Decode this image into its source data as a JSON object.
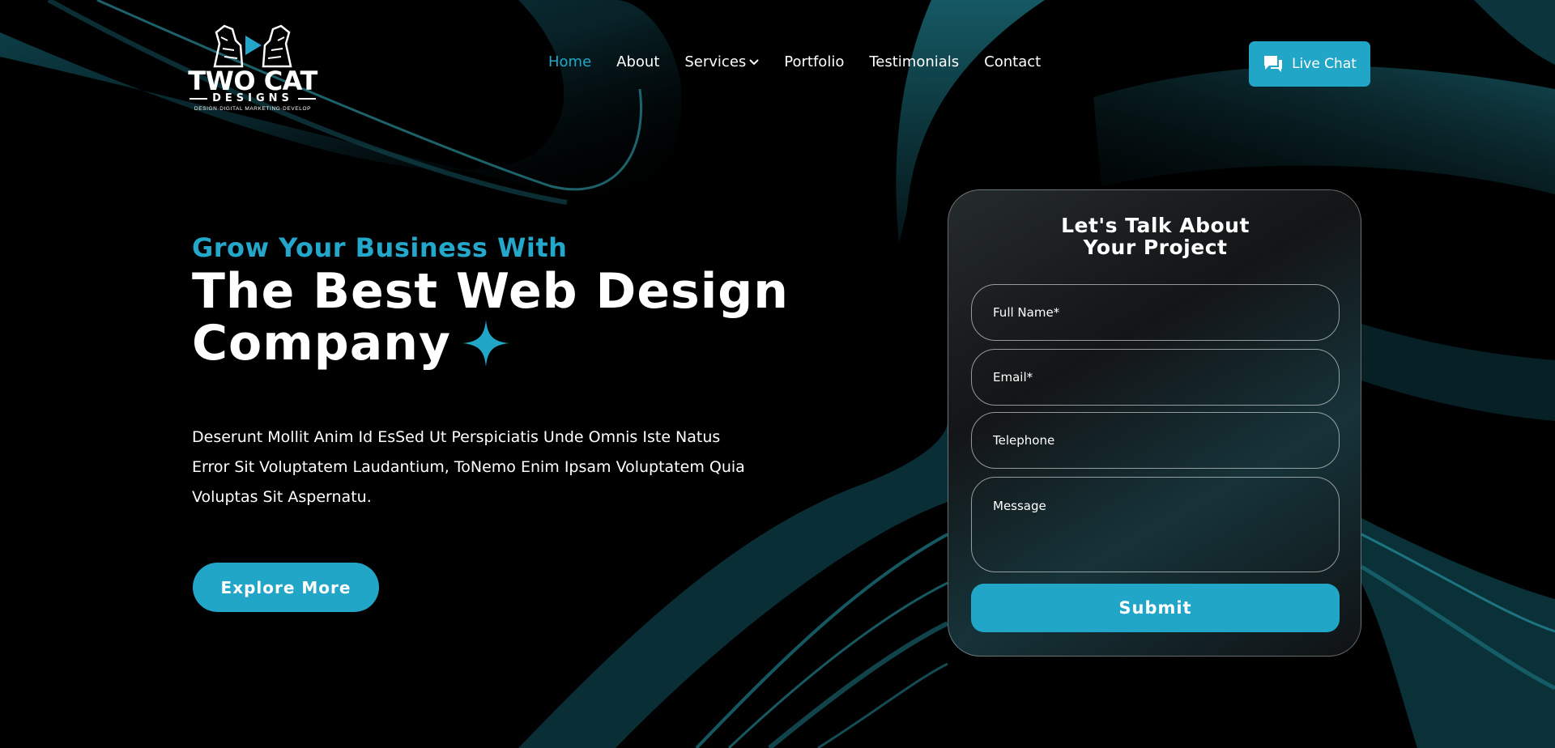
{
  "brand": {
    "name": "TWO CAT",
    "sub": "DESIGNS",
    "tagline": "DESIGN·DIGITAL MARKETING·DEVELOP"
  },
  "nav": {
    "items": [
      {
        "label": "Home",
        "active": true
      },
      {
        "label": "About",
        "active": false
      },
      {
        "label": "Services",
        "active": false,
        "has_dropdown": true
      },
      {
        "label": "Portfolio",
        "active": false
      },
      {
        "label": "Testimonials",
        "active": false
      },
      {
        "label": "Contact",
        "active": false
      }
    ]
  },
  "header": {
    "live_chat_label": "Live Chat",
    "live_chat_icon": "chat-bubble-icon"
  },
  "hero": {
    "eyebrow": "Grow Your Business With",
    "title_line1": "The Best Web Design",
    "title_line2": "Company",
    "title_icon": "sparkle-icon",
    "description": "Deserunt Mollit Anim Id EsSed Ut Perspiciatis Unde Omnis Iste Natus Error Sit Voluptatem   Laudantium, ToNemo Enim Ipsam Voluptatem Quia Voluptas Sit Aspernatu.",
    "cta_label": "Explore More"
  },
  "form": {
    "title_line1": "Let's Talk About",
    "title_line2": "Your Project",
    "full_name_placeholder": "Full Name*",
    "email_placeholder": "Email*",
    "telephone_placeholder": "Telephone",
    "message_placeholder": "Message",
    "submit_label": "Submit"
  },
  "colors": {
    "accent": "#22a6c8",
    "background": "#000000",
    "text": "#ffffff"
  }
}
